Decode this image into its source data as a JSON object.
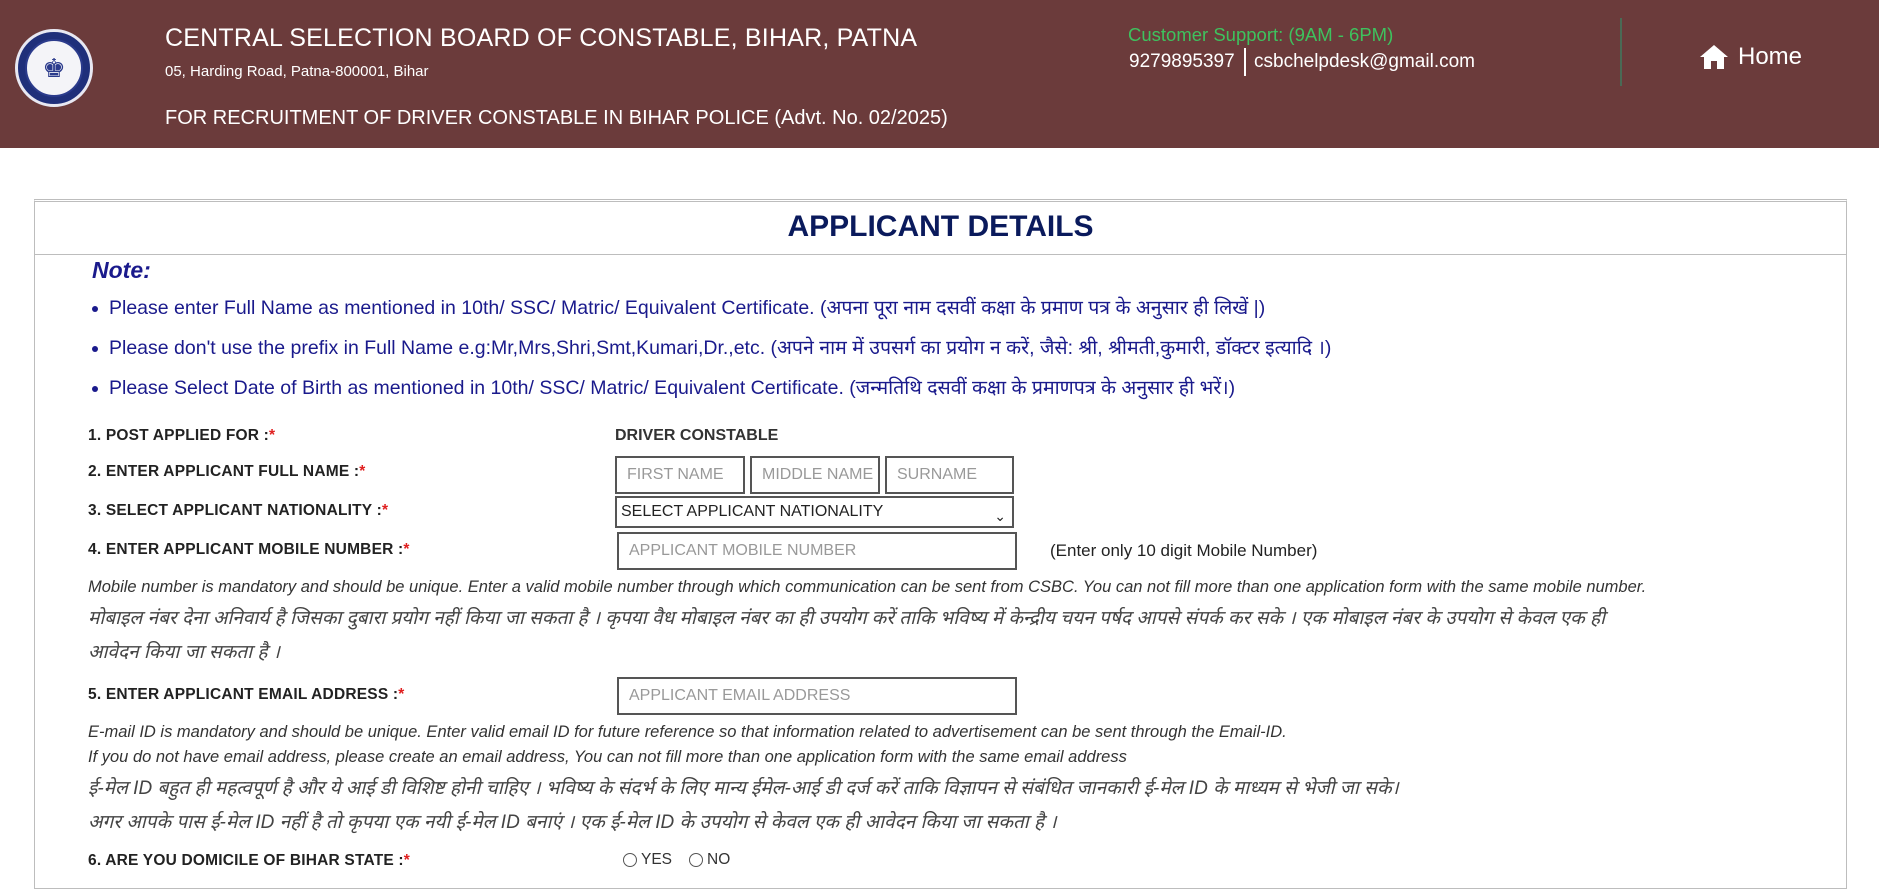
{
  "header": {
    "org_name": "CENTRAL SELECTION BOARD OF CONSTABLE, BIHAR, PATNA",
    "address": "05, Harding Road, Patna-800001, Bihar",
    "recruitment_line": "FOR RECRUITMENT OF DRIVER CONSTABLE IN BIHAR POLICE (Advt. No. 02/2025)",
    "support_label": "Customer Support: (9AM - 6PM)",
    "support_phone": "9279895397",
    "support_email": "csbchelpdesk@gmail.com",
    "home_label": "Home"
  },
  "form": {
    "title": "APPLICANT DETAILS",
    "note_title": "Note:",
    "notes": [
      "Please enter Full Name as mentioned in 10th/ SSC/ Matric/ Equivalent Certificate. (अपना पूरा नाम दसवीं कक्षा के प्रमाण पत्र के अनुसार ही लिखें |)",
      "Please don't use the prefix in Full Name e.g:Mr,Mrs,Shri,Smt,Kumari,Dr.,etc. (अपने नाम में उपसर्ग का प्रयोग न करें, जैसे: श्री, श्रीमती,कुमारी, डॉक्टर इत्यादि ।)",
      "Please Select Date of Birth as mentioned in 10th/ SSC/ Matric/ Equivalent Certificate. (जन्मतिथि दसवीं कक्षा के प्रमाणपत्र के अनुसार ही भरें।)"
    ],
    "fields": {
      "post_label": "1. POST APPLIED FOR :",
      "post_value": "DRIVER CONSTABLE",
      "name_label": "2. ENTER APPLICANT FULL NAME :",
      "first_name_placeholder": "FIRST NAME",
      "middle_name_placeholder": "MIDDLE NAME",
      "surname_placeholder": "SURNAME",
      "nationality_label": "3. SELECT APPLICANT NATIONALITY :",
      "nationality_selected": "SELECT APPLICANT NATIONALITY",
      "mobile_label": "4. ENTER APPLICANT MOBILE NUMBER :",
      "mobile_placeholder": "APPLICANT MOBILE NUMBER",
      "mobile_hint": "(Enter only 10 digit Mobile Number)",
      "mobile_info_en": "Mobile number is mandatory and should be unique. Enter a valid mobile number through which communication can be sent from CSBC. You can not fill more than one application form with the same mobile number.",
      "mobile_info_hi_1": "मोबाइल नंबर देना अनिवार्य है जिसका दुबारा प्रयोग नहीं किया जा सकता है । कृपया वैध मोबाइल नंबर का ही उपयोग करें ताकि भविष्य में केन्द्रीय चयन पर्षद आपसे संपर्क कर सके । एक मोबाइल नंबर के उपयोग से केवल एक ही",
      "mobile_info_hi_2": "आवेदन किया जा सकता है ।",
      "email_label": "5. ENTER APPLICANT EMAIL ADDRESS :",
      "email_placeholder": "APPLICANT EMAIL ADDRESS",
      "email_info_en_1": "E-mail ID is mandatory and should be unique. Enter valid email ID for future reference so that information related to advertisement can be sent through the Email-ID.",
      "email_info_en_2": "If you do not have email address, please create an email address, You can not fill more than one application form with the same email address",
      "email_info_hi_1": "ई-मेल ID बहुत ही महत्वपूर्ण है और ये आई डी विशिष्ट होनी चाहिए । भविष्य के संदर्भ के लिए मान्य ईमेल-आई डी दर्ज करें ताकि विज्ञापन  से संबंधित जानकारी ई-मेल ID के माध्यम से भेजी जा सके।",
      "email_info_hi_2": "अगर आपके पास ई-मेल ID नहीं है तो कृपया एक नयी ई-मेल ID बनाएं । एक ई-मेल ID के उपयोग से केवल एक ही आवेदन किया जा सकता है ।",
      "domicile_label": "6. ARE YOU DOMICILE OF BIHAR STATE :",
      "domicile_yes": "YES",
      "domicile_no": "NO",
      "required_mark": "*"
    }
  },
  "colors": {
    "header_bg": "#6b3b3b",
    "support_green": "#3ec25e",
    "note_blue": "#1a1a8c",
    "title_navy": "#0a1a5c",
    "required_red": "#e02020"
  }
}
